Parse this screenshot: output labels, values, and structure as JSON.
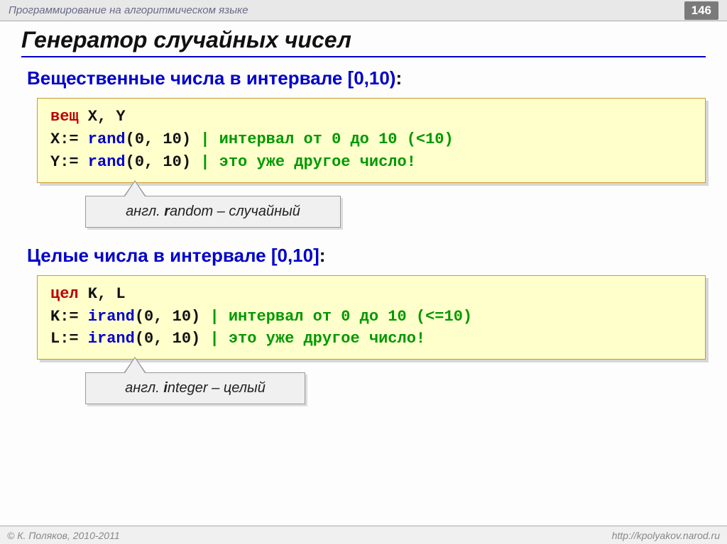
{
  "header": {
    "breadcrumb": "Программирование на алгоритмическом языке",
    "page_number": "146"
  },
  "title": "Генератор случайных чисел",
  "section1": {
    "heading": "Вещественные числа в интервале [0,10)",
    "code": {
      "line1_kw": "вещ",
      "line1_vars": " X, Y",
      "line2_pre": "X:=",
      "line2_fn": " rand",
      "line2_args": "(0, 10)",
      "line2_cmt": " | интервал от 0 до 10 (<10)",
      "line3_pre": "Y:=",
      "line3_fn": " rand",
      "line3_args": "(0, 10)",
      "line3_cmt": " | это уже другое число!"
    },
    "tip_prefix": "англ. ",
    "tip_bold": "r",
    "tip_rest": "andom – случайный"
  },
  "section2": {
    "heading": "Целые числа в интервале [0,10]",
    "code": {
      "line1_kw": "цел",
      "line1_vars": " K, L",
      "line2_pre": "K:=",
      "line2_fn": " irand",
      "line2_args": "(0, 10)",
      "line2_cmt": " | интервал от 0 до 10 (<=10)",
      "line3_pre": "L:=",
      "line3_fn": " irand",
      "line3_args": "(0, 10)",
      "line3_cmt": " | это уже другое число!"
    },
    "tip_prefix": "англ. ",
    "tip_bold": "i",
    "tip_rest": "nteger – целый"
  },
  "footer": {
    "left": "© К. Поляков, 2010-2011",
    "right": "http://kpolyakov.narod.ru"
  }
}
